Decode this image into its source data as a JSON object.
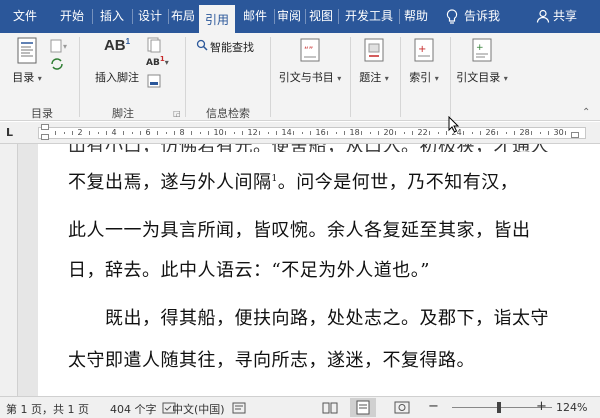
{
  "tabs": [
    {
      "label": "文件",
      "active": false
    },
    {
      "label": "开始",
      "active": false
    },
    {
      "label": "插入",
      "active": false
    },
    {
      "label": "设计",
      "active": false
    },
    {
      "label": "布局",
      "active": false
    },
    {
      "label": "引用",
      "active": true
    },
    {
      "label": "邮件",
      "active": false
    },
    {
      "label": "审阅",
      "active": false
    },
    {
      "label": "视图",
      "active": false
    },
    {
      "label": "开发工具",
      "active": false
    },
    {
      "label": "帮助",
      "active": false
    }
  ],
  "tell_me": "告诉我",
  "share": "共享",
  "ribbon": {
    "toc_button": "目录",
    "toc_group": "目录",
    "insert_footnote": "插入脚注",
    "footnote_group": "脚注",
    "smart_lookup": "智能查找",
    "research_group": "信息检索",
    "citations": "引文与书目",
    "captions": "题注",
    "index": "索引",
    "toa": "引文目录",
    "ab_label": "AB",
    "ab_superscript": "1"
  },
  "ruler_numbers": [
    "2",
    "4",
    "6",
    "8",
    "10",
    "12",
    "14",
    "16",
    "18",
    "20",
    "22",
    "24",
    "26",
    "28",
    "30"
  ],
  "ruler_mark": "L",
  "document": {
    "lines": [
      {
        "text": "不复出焉，遂与外人间隔",
        "sup": "1",
        "rest": "。问今是何世，乃不知有汉，"
      },
      {
        "text": "此人一一为具言所闻，皆叹惋。余人各复延至其家，皆出"
      },
      {
        "text": "日，辞去。此中人语云：“不足为外人道也。”"
      },
      {
        "text": "　　既出，得其船，便扶向路，处处志之。及郡下，诣太守"
      },
      {
        "text": "太守即遣人随其往，寻向所志，遂迷，不复得路。"
      }
    ]
  },
  "status": {
    "page": "第 1 页，共 1 页",
    "words": "404 个字",
    "language": "中文(中国)",
    "zoom": "124%",
    "zoom_minus": "−",
    "zoom_plus": "+"
  },
  "colors": {
    "accent": "#2b579a",
    "ribbon_bg": "#f3f3f3"
  }
}
